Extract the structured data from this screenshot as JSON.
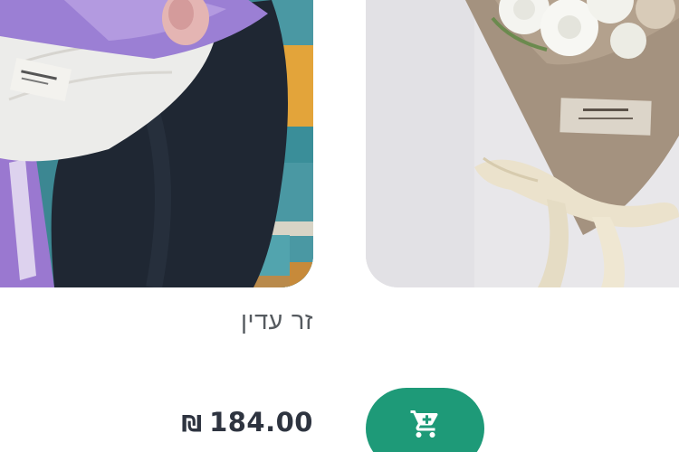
{
  "product": {
    "title": "זר עדין",
    "price_amount": "184.00",
    "price_currency": "₪"
  },
  "icons": {
    "cart": "shopping-cart-icon"
  },
  "colors": {
    "accent": "#1e9a78",
    "title": "#555a5f",
    "price": "#2e3440",
    "background": "#ffffff"
  }
}
